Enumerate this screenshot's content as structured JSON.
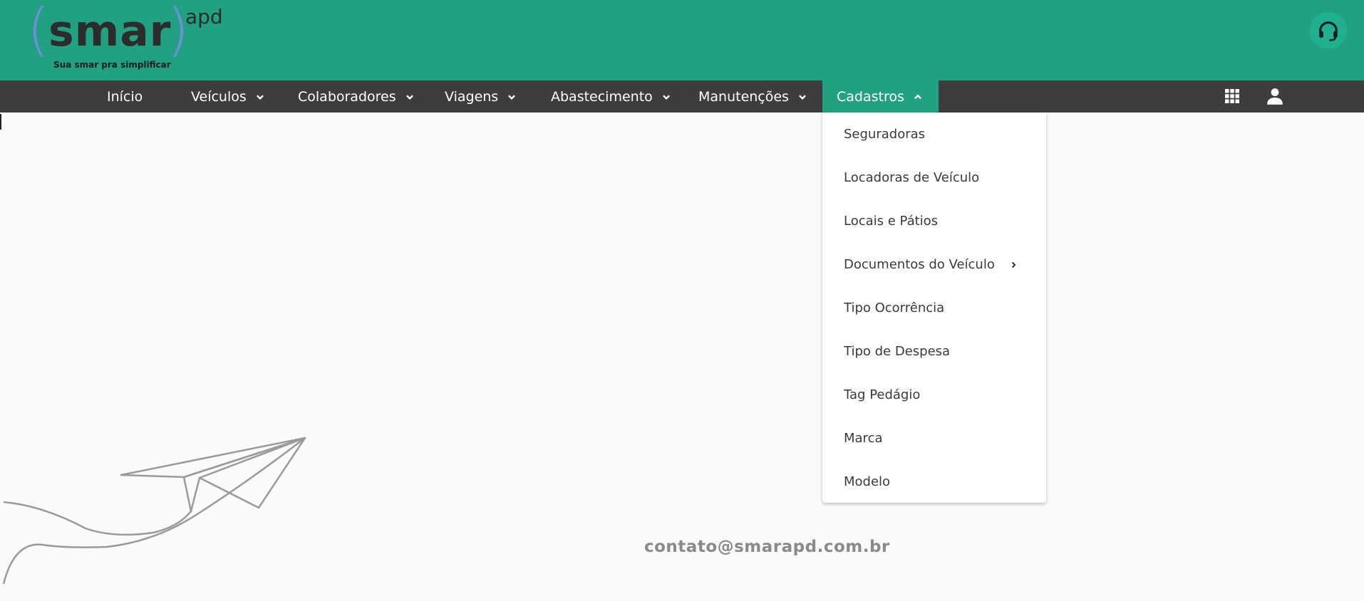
{
  "header": {
    "logo": {
      "word": "smar",
      "suffix": "apd",
      "tagline": "Sua smar pra simplificar"
    },
    "support_icon": "headset-icon"
  },
  "nav": {
    "items": [
      {
        "label": "Início"
      },
      {
        "label": "Veículos"
      },
      {
        "label": "Colaboradores"
      },
      {
        "label": "Viagens"
      },
      {
        "label": "Abastecimento"
      },
      {
        "label": "Manutenções"
      },
      {
        "label": "Cadastros",
        "active": true
      }
    ],
    "right_icons": [
      "apps-grid-icon",
      "user-icon"
    ]
  },
  "dropdown": {
    "items": [
      {
        "label": "Seguradoras"
      },
      {
        "label": "Locadoras de Veículo"
      },
      {
        "label": "Locais e Pátios"
      },
      {
        "label": "Documentos do Veículo",
        "has_submenu": true
      },
      {
        "label": "Tipo Ocorrência"
      },
      {
        "label": "Tipo de Despesa"
      },
      {
        "label": "Tag Pedágio"
      },
      {
        "label": "Marca"
      },
      {
        "label": "Modelo"
      }
    ]
  },
  "footer": {
    "contact": "contato@smarapd.com.br"
  },
  "colors": {
    "header_bg": "#21a082",
    "nav_bg": "#3d3d3d",
    "active_tab": "#21a082"
  }
}
